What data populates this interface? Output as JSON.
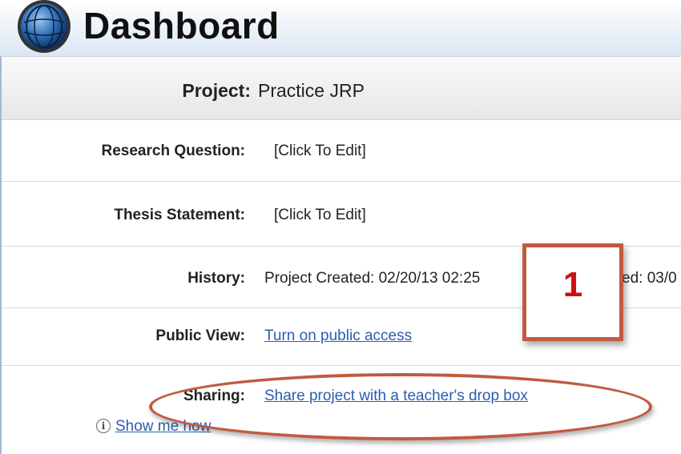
{
  "header": {
    "title": "Dashboard",
    "logo_icon": "globe-logo-icon"
  },
  "project": {
    "label": "Project:",
    "name": "Practice JRP"
  },
  "fields": {
    "research_question": {
      "label": "Research Question:",
      "value": "[Click To Edit]"
    },
    "thesis_statement": {
      "label": "Thesis Statement:",
      "value": "[Click To Edit]"
    },
    "history": {
      "label": "History:",
      "value": "Project Created: 02/20/13 02:25",
      "value_tail": "ed: 03/0"
    },
    "public_view": {
      "label": "Public View:",
      "link": "Turn on public access"
    },
    "sharing": {
      "label": "Sharing:",
      "link": "Share project with a teacher's drop box"
    }
  },
  "help": {
    "icon": "info-icon",
    "link": "Show me how"
  },
  "annotation": {
    "number": "1",
    "color": "#c05a40",
    "number_color": "#cc1111"
  },
  "colors": {
    "link": "#2a5db0",
    "header_gradient_end": "#dbe6f3"
  }
}
